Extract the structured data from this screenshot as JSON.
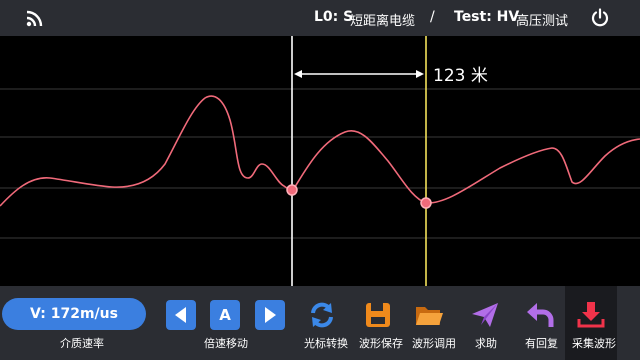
{
  "header": {
    "lo_label": "L0: S",
    "lo_value": "短距离电缆",
    "separator": "/",
    "test_label": "Test: HV",
    "test_value": "高压测试"
  },
  "plot": {
    "distance_label": "123 米",
    "colors": {
      "trace": "#f06a7a",
      "cursor_left": "#ffffff",
      "cursor_right": "#f2e25a",
      "grid": "#3a3a3a"
    }
  },
  "toolbar": {
    "speed_value": "V:  172m/us",
    "speed_label": "介质速率",
    "move_label": "倍速移动",
    "a_label": "A",
    "cursor_switch_label": "光标转换",
    "save_label": "波形保存",
    "load_label": "波形调用",
    "help_label": "求助",
    "replay_label": "有回复",
    "collect_label": "采集波形"
  },
  "icons": [
    "wifi-icon",
    "power-icon",
    "arrow-left-icon",
    "arrow-right-icon",
    "refresh-icon",
    "save-icon",
    "folder-icon",
    "send-icon",
    "undo-icon",
    "download-icon"
  ]
}
